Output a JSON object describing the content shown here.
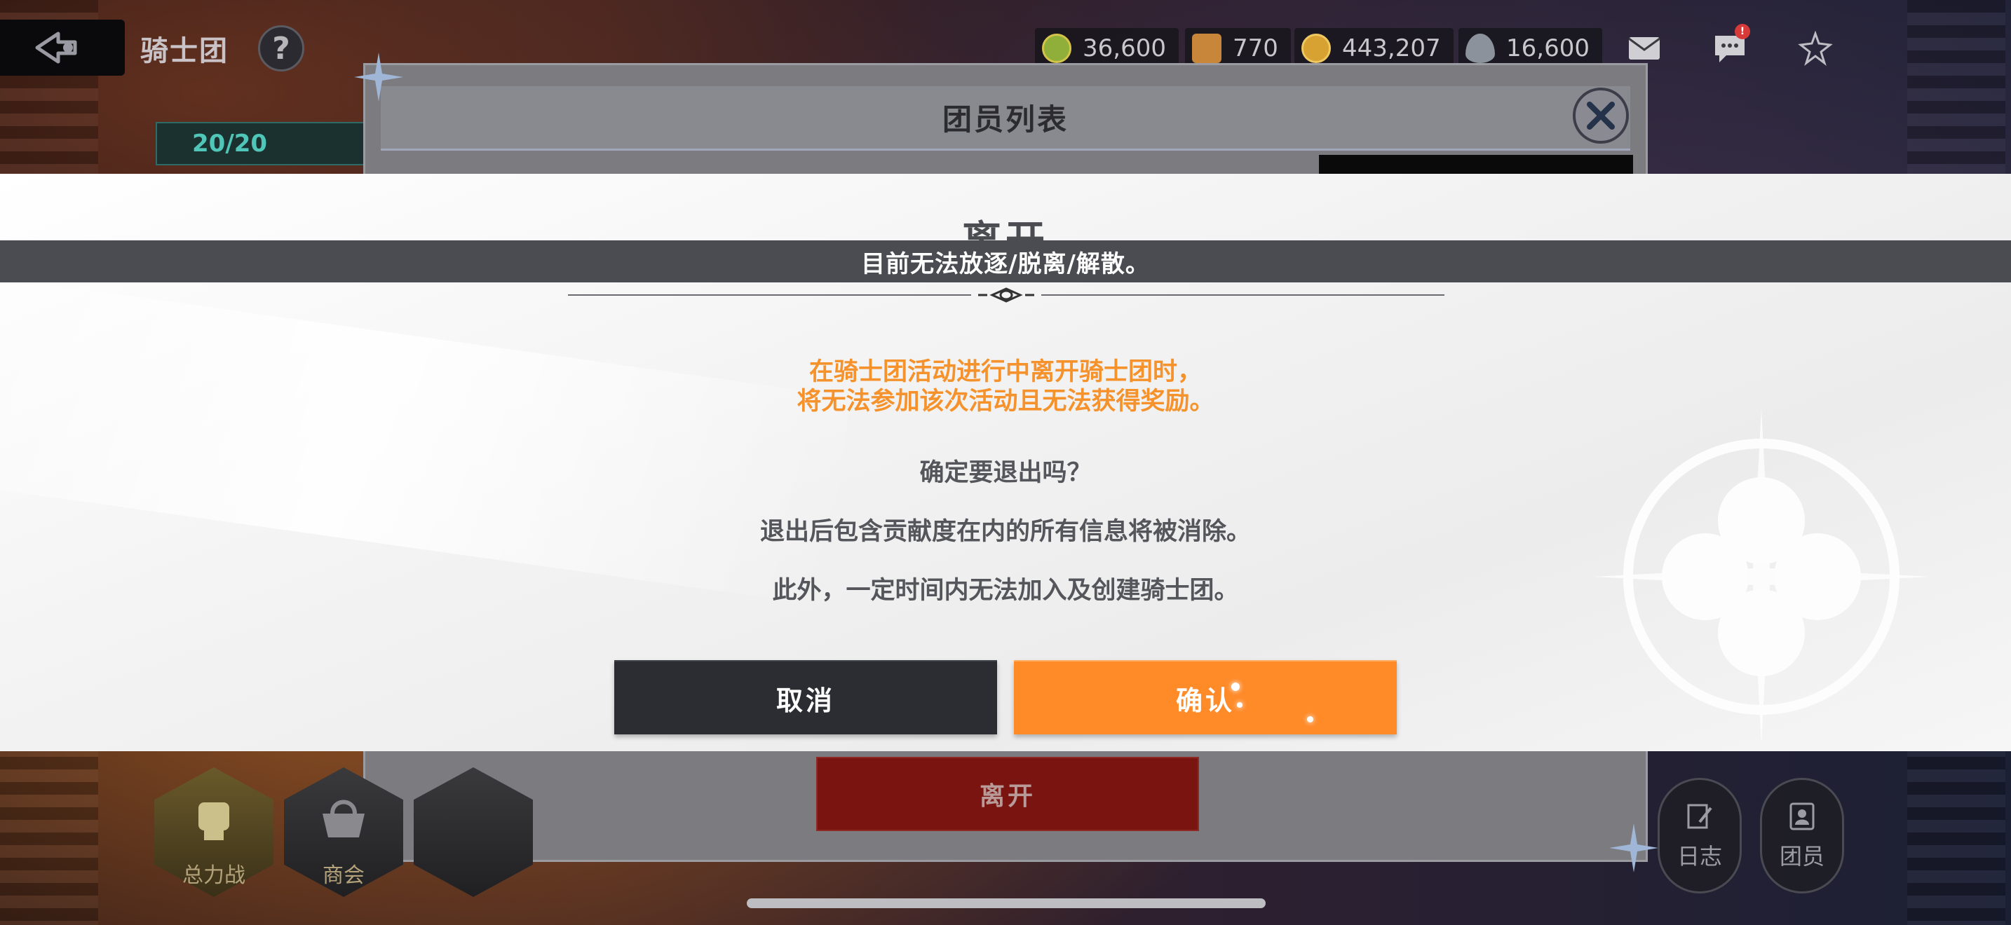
{
  "top_bar": {
    "title": "骑士团",
    "help_label": "?",
    "resources": [
      {
        "icon": "clover-coin-icon",
        "value": "36,600",
        "color": "#8fae3a"
      },
      {
        "icon": "medal-icon",
        "value": "770",
        "color": "#d0a54a"
      },
      {
        "icon": "gold-coin-icon",
        "value": "443,207",
        "color": "#d7a232"
      },
      {
        "icon": "crystal-icon",
        "value": "16,600",
        "color": "#9aa0a8"
      }
    ],
    "chat_badge": "!"
  },
  "member_panel": {
    "title": "团员列表",
    "member_count": "20/20",
    "leave_button": "离开"
  },
  "bottom_nav": {
    "items": [
      "总力战",
      "商会"
    ],
    "log_label": "日志",
    "members_label": "团员"
  },
  "modal": {
    "title": "离开",
    "toast": "目前无法放逐/脱离/解散。",
    "warning_line1": "在骑士团活动进行中离开骑士团时，",
    "warning_line2": "将无法参加该次活动且无法获得奖励。",
    "confirm_question": "确定要退出吗？",
    "info_line1": "退出后包含贡献度在内的所有信息将被消除。",
    "info_line2": "此外，一定时间内无法加入及创建骑士团。",
    "cancel_label": "取消",
    "confirm_label": "确认"
  },
  "colors": {
    "accent_orange": "#ff8a28",
    "warning_text": "#f5922c",
    "dark_button": "#2b2d33",
    "leave_red": "#7a1410"
  }
}
